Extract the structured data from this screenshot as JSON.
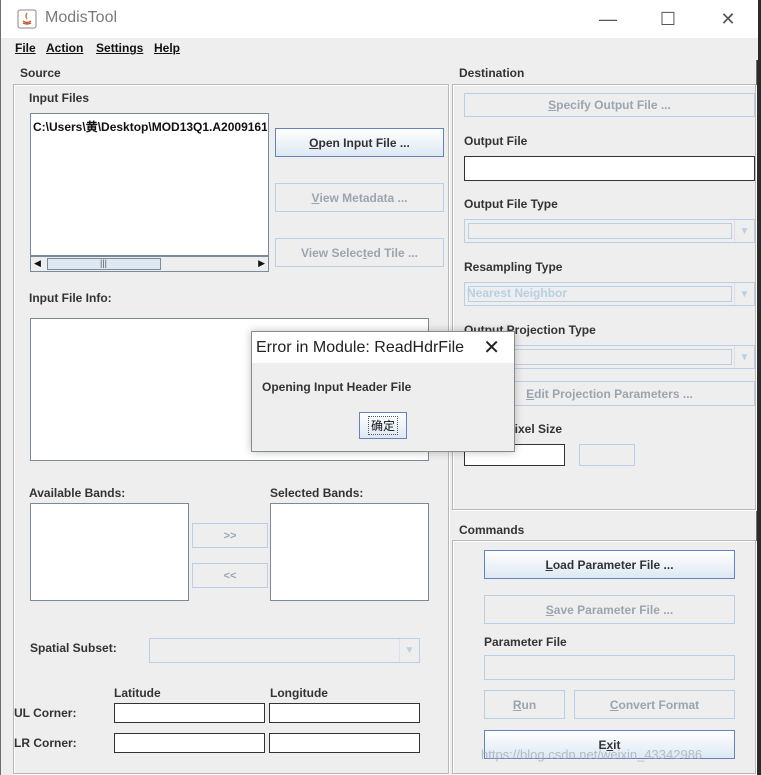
{
  "window": {
    "title": "ModisTool",
    "controls": {
      "minimize": "—",
      "maximize": "☐",
      "close": "✕"
    }
  },
  "menu": [
    {
      "key": "F",
      "rest": "ile"
    },
    {
      "key": "A",
      "rest": "ction"
    },
    {
      "key": "S",
      "rest": "ettings"
    },
    {
      "key": "H",
      "rest": "elp"
    }
  ],
  "source": {
    "title": "Source",
    "input_files_label": "Input Files",
    "input_file_path": "C:\\Users\\黄\\Desktop\\MOD13Q1.A2009161",
    "open_input_button": {
      "key": "O",
      "rest": "pen Input File ..."
    },
    "view_metadata_button": {
      "key": "V",
      "rest": "iew Metadata ..."
    },
    "view_selected_tile_button": {
      "pre": "View Selec",
      "key": "t",
      "rest": "ed Tile ..."
    },
    "input_file_info_label": "Input File Info:",
    "available_bands_label": "Available Bands:",
    "selected_bands_label": "Selected Bands:",
    "add_band_button": ">>",
    "remove_band_button": "<<",
    "spatial_subset_label": "Spatial Subset:",
    "latitude_label": "Latitude",
    "longitude_label": "Longitude",
    "ul_corner_label": "UL Corner:",
    "lr_corner_label": "LR Corner:"
  },
  "destination": {
    "title": "Destination",
    "specify_output_button": {
      "pre": "",
      "key": "S",
      "rest": "pecify Output File ..."
    },
    "output_file_label": "Output File",
    "output_file_type_label": "Output File Type",
    "resampling_type_label": "Resampling Type",
    "resampling_value": "Nearest Neighbor",
    "output_projection_label": "Output Projection Type",
    "edit_projection_button": {
      "key": "E",
      "rest": "dit Projection Parameters ..."
    },
    "pixel_size_label": "Output Pixel Size"
  },
  "commands": {
    "title": "Commands",
    "load_param_button": {
      "key": "L",
      "rest": "oad Parameter File ..."
    },
    "save_param_button": {
      "key": "S",
      "rest": "ave Parameter File ..."
    },
    "parameter_file_label": "Parameter File",
    "run_button": {
      "key": "R",
      "rest": "un"
    },
    "convert_button": {
      "key": "C",
      "rest": "onvert Format"
    },
    "exit_button": {
      "pre": "E",
      "key": "x",
      "rest": "it"
    }
  },
  "dialog": {
    "title": "Error in Module: ReadHdrFile",
    "close": "✕",
    "message": "Opening Input Header File",
    "ok_button": "确定"
  },
  "watermark": "https://blog.csdn.net/weixin_43342986",
  "colors": {
    "accent_border": "#6382bf",
    "disabled_text": "#9aa5b0",
    "background": "#eeeeee"
  }
}
